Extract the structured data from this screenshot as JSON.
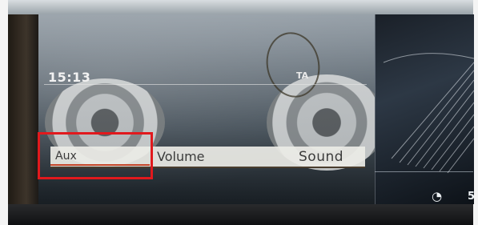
{
  "status": {
    "time": "15:13",
    "traffic_announcement": "TA"
  },
  "menu": {
    "items": [
      {
        "label": "Aux"
      },
      {
        "label": "Volume"
      },
      {
        "label": "Sound"
      }
    ],
    "selected": "Aux"
  },
  "cluster": {
    "speed_icon": "speedometer-icon",
    "speed_value": "5"
  },
  "colors": {
    "highlight": "#e1191d",
    "selection_underline": "#c4462a",
    "menu_text": "#3b3b3b"
  }
}
